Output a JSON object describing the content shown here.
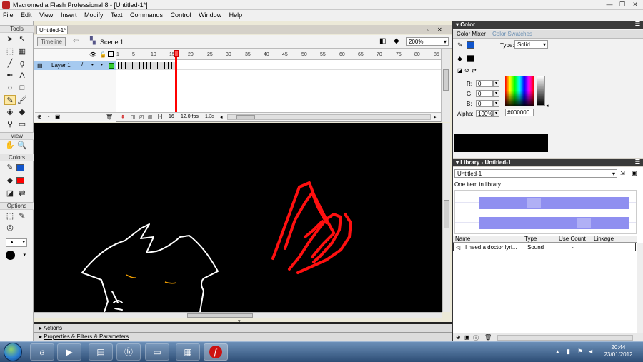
{
  "window": {
    "title": "Macromedia Flash Professional 8 - [Untitled-1*]",
    "minimize": "—",
    "restore": "❐",
    "close": "✕"
  },
  "menu": [
    "File",
    "Edit",
    "View",
    "Insert",
    "Modify",
    "Text",
    "Commands",
    "Control",
    "Window",
    "Help"
  ],
  "tools": {
    "section_tools": "Tools",
    "section_view": "View",
    "section_colors": "Colors",
    "section_options": "Options"
  },
  "document": {
    "tab": "Untitled-1*",
    "timeline_button": "Timeline",
    "scene": "Scene 1",
    "zoom": "200%"
  },
  "timeline": {
    "layer_name": "Layer 1",
    "frame_numbers": [
      "1",
      "5",
      "10",
      "15",
      "20",
      "25",
      "30",
      "35",
      "40",
      "45",
      "50",
      "55",
      "60",
      "65",
      "70",
      "75",
      "80",
      "85"
    ],
    "current_frame": "16",
    "frame_rate": "12.0 fps",
    "elapsed": "1.3s"
  },
  "bottom_panels": {
    "actions": "Actions",
    "properties": "Properties & Filters & Parameters"
  },
  "color": {
    "panel_title": "Color",
    "tab_mixer": "Color Mixer",
    "tab_swatches": "Color Swatches",
    "type_label": "Type:",
    "type_value": "Solid",
    "r_label": "R:",
    "r_value": "0",
    "g_label": "G:",
    "g_value": "0",
    "b_label": "B:",
    "b_value": "0",
    "alpha_label": "Alpha:",
    "alpha_value": "100%",
    "hex": "#000000",
    "stroke_color": "#1155cc",
    "fill_color": "#000000",
    "preview_color": "#000000"
  },
  "library": {
    "panel_title": "Library - Untitled-1",
    "selected": "Untitled-1",
    "count": "One item in library",
    "col_name": "Name",
    "col_type": "Type",
    "col_use": "Use Count",
    "col_linkage": "Linkage",
    "item_name": "I need a doctor lyri...",
    "item_type": "Sound",
    "item_use": "-"
  },
  "taskbar": {
    "time": "20:44",
    "date": "23/01/2012"
  }
}
